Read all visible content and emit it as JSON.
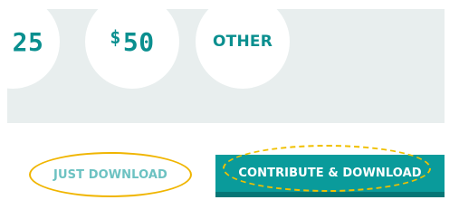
{
  "amounts": {
    "partial_amount": "25",
    "second_currency": "$",
    "second_amount": "50",
    "other_label": "OTHER"
  },
  "buttons": {
    "just_download_label": "JUST DOWNLOAD",
    "contribute_label": "CONTRIBUTE & DOWNLOAD"
  },
  "colors": {
    "accent_teal": "#0a9b9b",
    "teal_dark": "#067676",
    "panel_bg": "#e8eeee",
    "highlight_yellow": "#f0b500",
    "link_teal_light": "#6cc2c2"
  }
}
